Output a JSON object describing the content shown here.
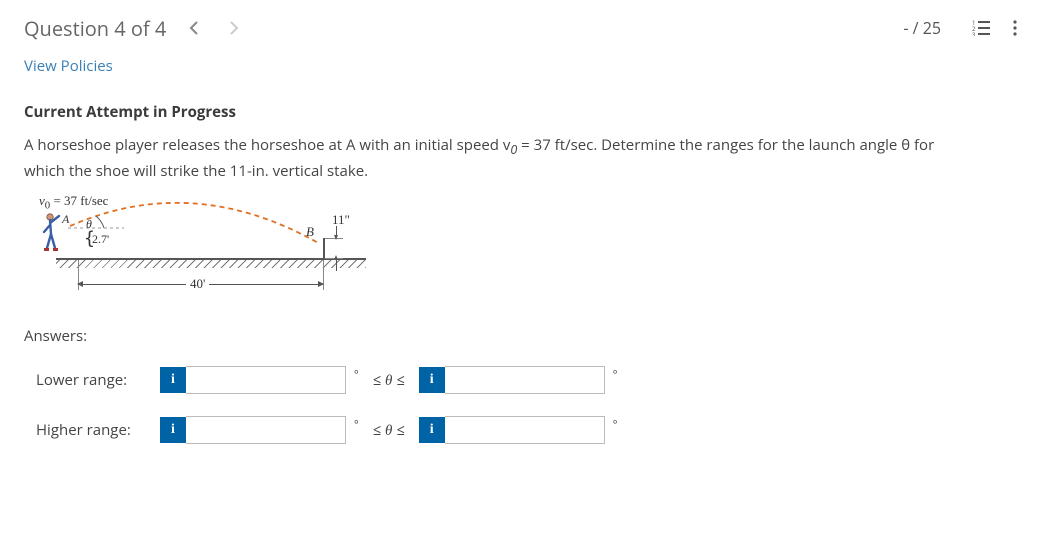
{
  "header": {
    "question_title": "Question 4 of 4",
    "score": "- / 25"
  },
  "links": {
    "view_policies": "View Policies"
  },
  "attempt_heading": "Current Attempt in Progress",
  "prompt": {
    "pre": "A horseshoe player releases the horseshoe at A with an initial speed v",
    "sub": "0",
    "post": " = 37 ft/sec. Determine the ranges for the launch angle θ for which the shoe will strike the 11-in. vertical stake."
  },
  "figure": {
    "v0_label_pre": "v",
    "v0_label_sub": "0",
    "v0_label_post": " = 37 ft/sec",
    "point_A": "A",
    "point_B": "B",
    "angle_label": "θ",
    "release_height": "2.7'",
    "stake_height": "11\"",
    "horizontal_distance": "40'"
  },
  "answers": {
    "label": "Answers:",
    "lower_label": "Lower range:",
    "higher_label": "Higher range:",
    "between": "≤ θ ≤",
    "degree": "°",
    "info_glyph": "i",
    "lower_a": "",
    "lower_b": "",
    "higher_a": "",
    "higher_b": ""
  }
}
